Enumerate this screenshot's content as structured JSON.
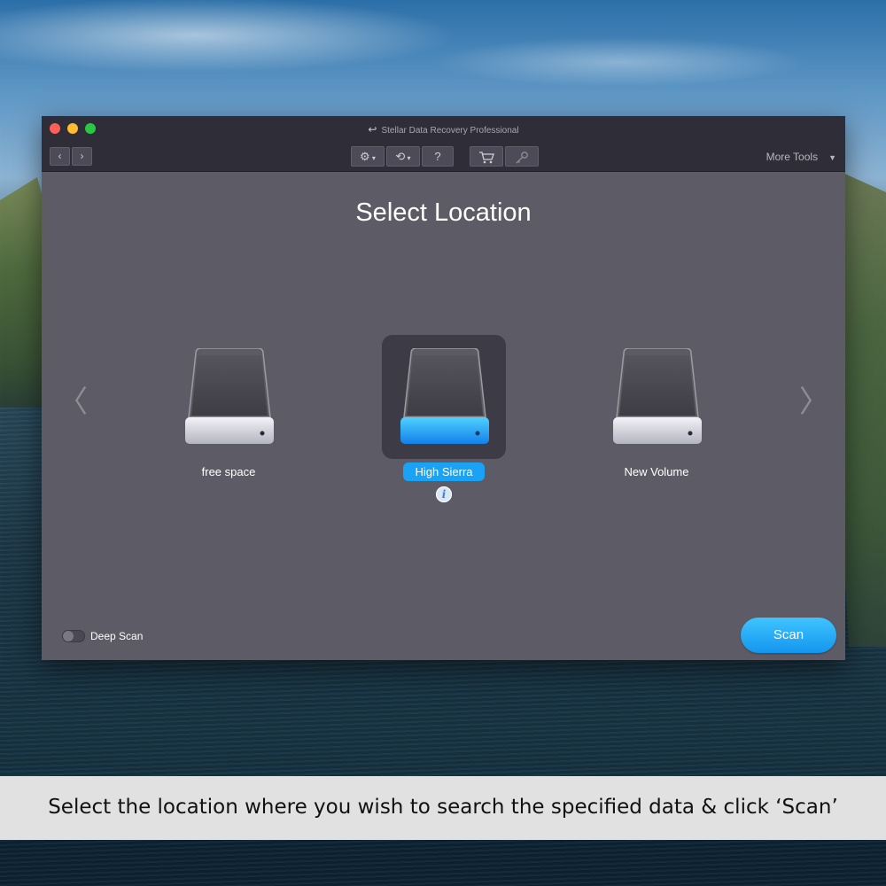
{
  "window": {
    "title": "Stellar Data Recovery Professional"
  },
  "toolbar": {
    "back_label": "‹",
    "forward_label": "›",
    "settings_icon": "gear-icon",
    "history_icon": "history-icon",
    "help_label": "?",
    "cart_icon": "cart-icon",
    "key_icon": "key-icon",
    "more_tools_label": "More Tools"
  },
  "main": {
    "heading": "Select Location",
    "drives": [
      {
        "label": "free space",
        "selected": false
      },
      {
        "label": "High Sierra",
        "selected": true
      },
      {
        "label": "New Volume",
        "selected": false
      }
    ],
    "info_glyph": "i"
  },
  "footer": {
    "deep_scan_label": "Deep Scan",
    "deep_scan_enabled": false,
    "scan_label": "Scan"
  },
  "caption": "Select the location where you wish to search the specified data & click ‘Scan’",
  "colors": {
    "accent": "#1aa3f4",
    "window_bg": "#5d5c66",
    "titlebar_bg": "#2f2d38"
  }
}
